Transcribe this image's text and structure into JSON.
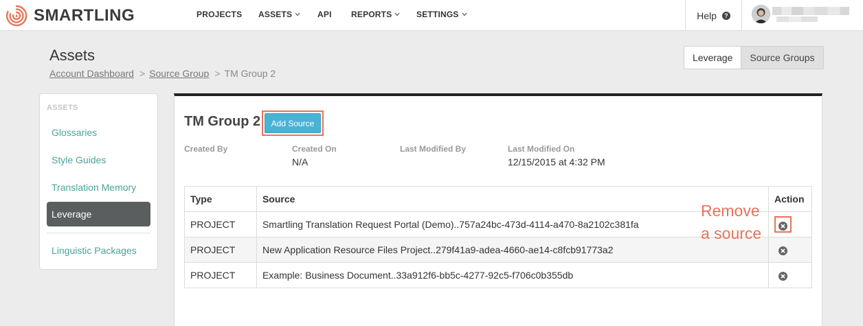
{
  "brand": {
    "name": "SMARTLING",
    "accent": "#e8735b",
    "teal": "#4aa39b",
    "button": "#49b3d6"
  },
  "nav": {
    "items": [
      {
        "label": "PROJECTS"
      },
      {
        "label": "ASSETS"
      },
      {
        "label": "API"
      },
      {
        "label": "REPORTS"
      },
      {
        "label": "SETTINGS"
      }
    ],
    "help": "Help"
  },
  "page": {
    "title": "Assets",
    "breadcrumb": [
      "Account Dashboard",
      "Source Group",
      "TM Group 2"
    ],
    "separator": ">",
    "toggle": [
      "Leverage",
      "Source Groups"
    ]
  },
  "sidebar": {
    "heading": "ASSETS",
    "items": [
      {
        "label": "Glossaries"
      },
      {
        "label": "Style Guides"
      },
      {
        "label": "Translation Memory"
      },
      {
        "label": "Leverage"
      },
      {
        "label": "Linguistic Packages"
      }
    ]
  },
  "main": {
    "title": "TM Group 2",
    "add_button": "Add Source",
    "meta": [
      {
        "label": "Created By",
        "value": ""
      },
      {
        "label": "Created On",
        "value": "N/A"
      },
      {
        "label": "Last Modified By",
        "value": ""
      },
      {
        "label": "Last Modified On",
        "value": "12/15/2015 at 4:32 PM"
      }
    ],
    "table": {
      "headers": [
        "Type",
        "Source",
        "Action"
      ],
      "rows": [
        {
          "type": "PROJECT",
          "source": "Smartling Translation Request Portal (Demo)..757a24bc-473d-4114-a470-8a2102c381fa"
        },
        {
          "type": "PROJECT",
          "source": "New Application Resource Files Project..279f41a9-adea-4660-ae14-c8fcb91773a2"
        },
        {
          "type": "PROJECT",
          "source": "Example: Business Document..33a912f6-bb5c-4277-92c5-f706c0b355db"
        }
      ]
    }
  },
  "annotation": {
    "line1": "Remove",
    "line2": "a source"
  }
}
